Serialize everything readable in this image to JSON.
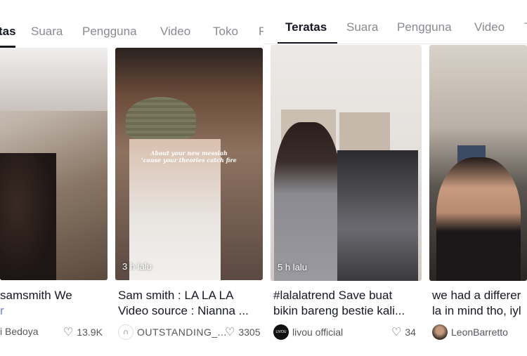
{
  "left_panel": {
    "tabs": [
      {
        "label": "tas",
        "active": true
      },
      {
        "label": "Suara"
      },
      {
        "label": "Pengguna"
      },
      {
        "label": "Video"
      },
      {
        "label": "Toko"
      },
      {
        "label": "F"
      }
    ],
    "cards": [
      {
        "caption_lines": [
          "samsmith We",
          "r"
        ],
        "author": "i Bedoya",
        "likes": "13.9K"
      },
      {
        "caption_lines": [
          "Sam smith : LA LA LA",
          "Video source : Nianna ..."
        ],
        "overlay_text": "About your new messiah 'cause your theories catch fire",
        "time": "3 h lalu",
        "author": "OUTSTANDING_...",
        "author_icon": "headphones-icon",
        "likes": "3305"
      }
    ]
  },
  "right_panel": {
    "tabs": [
      {
        "label": "Teratas",
        "active": true
      },
      {
        "label": "Suara"
      },
      {
        "label": "Pengguna"
      },
      {
        "label": "Video"
      },
      {
        "label": "T"
      }
    ],
    "cards": [
      {
        "caption_lines": [
          "#lalalatrend Save buat",
          "bikin bareng bestie kali..."
        ],
        "time": "5 h lalu",
        "author": "livou official",
        "avatar_text": "LIVOU",
        "likes": "34"
      },
      {
        "caption_lines": [
          "we had a differer",
          "la in mind tho, iyl"
        ],
        "author": "LeonBarretto"
      }
    ]
  },
  "colors": {
    "text": "#161823",
    "muted": "#8a8b91",
    "accent": "#161823"
  }
}
